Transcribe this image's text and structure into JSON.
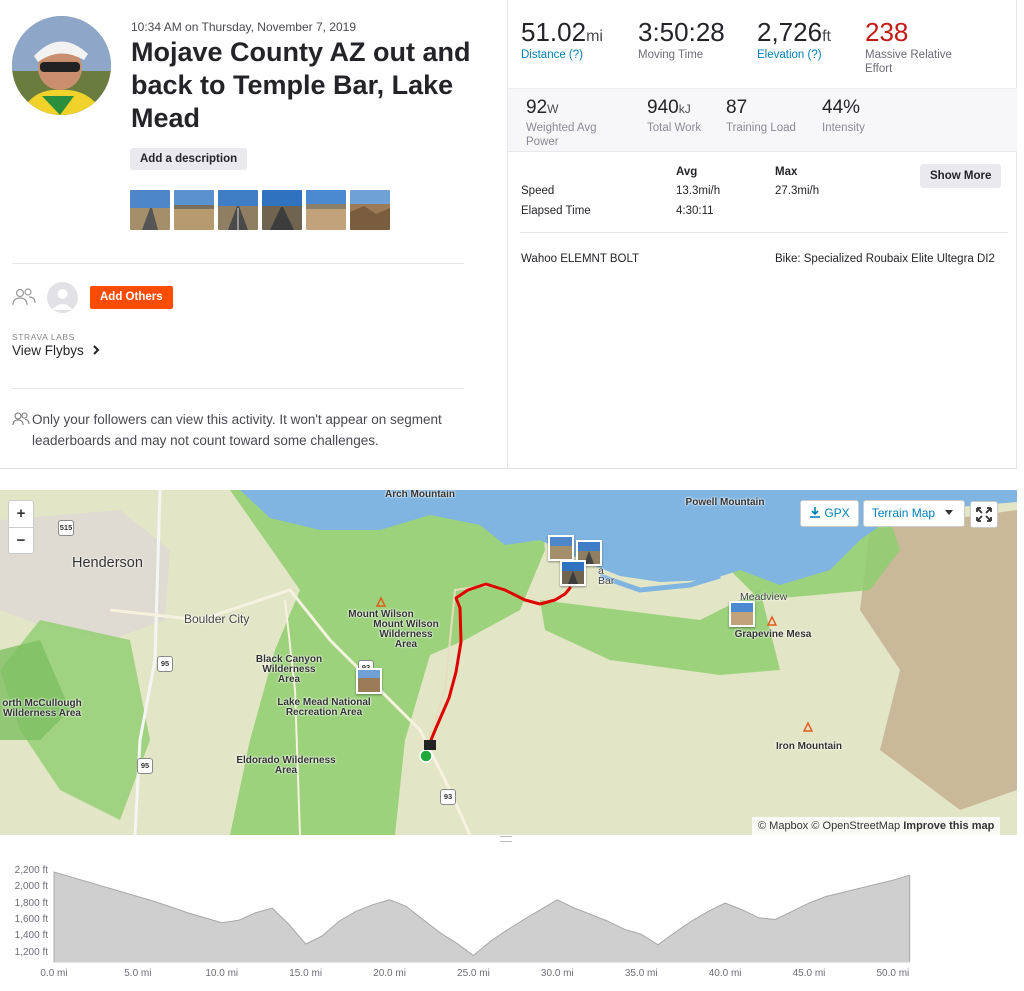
{
  "activity": {
    "timestamp": "10:34 AM on Thursday, November 7, 2019",
    "title": "Mojave County AZ out and back to Temple Bar, Lake Mead",
    "add_description_label": "Add a description",
    "photo_count": 6
  },
  "social": {
    "add_others_label": "Add Others",
    "labs_label": "STRAVA LABS",
    "flybys_label": "View Flybys",
    "privacy_text": "Only your followers can view this activity. It won't appear on segment leaderboards and may not count toward some challenges."
  },
  "stats": {
    "distance": {
      "value": "51.02",
      "unit": "mi",
      "label": "Distance (?)"
    },
    "moving_time": {
      "value": "3:50:28",
      "label": "Moving Time"
    },
    "elevation": {
      "value": "2,726",
      "unit": "ft",
      "label": "Elevation (?)"
    },
    "relative_effort": {
      "value": "238",
      "label": "Massive Relative Effort"
    }
  },
  "secondary_stats": {
    "power": {
      "value": "92",
      "unit": "W",
      "label": "Weighted Avg Power"
    },
    "work": {
      "value": "940",
      "unit": "kJ",
      "label": "Total Work"
    },
    "training_load": {
      "value": "87",
      "label": "Training Load"
    },
    "intensity": {
      "value": "44%",
      "label": "Intensity"
    }
  },
  "details_table": {
    "col_avg": "Avg",
    "col_max": "Max",
    "rows": [
      {
        "label": "Speed",
        "avg": "13.3mi/h",
        "max": "27.3mi/h"
      },
      {
        "label": "Elapsed Time",
        "avg": "4:30:11",
        "max": ""
      }
    ],
    "show_more_label": "Show More"
  },
  "device": "Wahoo ELEMNT BOLT",
  "bike": "Bike: Specialized Roubaix Elite Ultegra DI2",
  "map": {
    "gpx_label": "GPX",
    "terrain_label": "Terrain Map",
    "zoom_in": "+",
    "zoom_out": "−",
    "attribution": "© Mapbox © OpenStreetMap",
    "improve_label": "Improve this map",
    "labels": {
      "arch": "Arch Mountain",
      "powell": "Powell Mountain",
      "henderson": "Henderson",
      "boulder": "Boulder City",
      "mtwilson": "Mount Wilson",
      "mtwilsonwild": "Mount Wilson Wilderness Area",
      "blackcanyon": "Black Canyon Wilderness Area",
      "lakemead": "Lake Mead National Recreation Area",
      "mccullough": "orth McCullough Wilderness Area",
      "eldorado": "Eldorado Wilderness Area",
      "meadview": "Meadview",
      "grapevine": "Grapevine Mesa",
      "iron": "Iron Mountain",
      "templebar": "a Bar",
      "hwy515": "515",
      "hwy95a": "95",
      "hwy95b": "95",
      "hwy93a": "93",
      "hwy93b": "93"
    },
    "route_color": "#e00000",
    "water_color": "#7fb5e0",
    "park_color": "#8fce6f"
  },
  "elevation_profile": {
    "y_ticks": [
      "2,200 ft",
      "2,000 ft",
      "1,800 ft",
      "1,600 ft",
      "1,400 ft",
      "1,200 ft"
    ],
    "x_ticks": [
      "0.0 mi",
      "5.0 mi",
      "10.0 mi",
      "15.0 mi",
      "20.0 mi",
      "25.0 mi",
      "30.0 mi",
      "35.0 mi",
      "40.0 mi",
      "45.0 mi",
      "50.0 mi"
    ],
    "profile": [
      [
        0,
        2200
      ],
      [
        2,
        2080
      ],
      [
        4,
        1960
      ],
      [
        6,
        1840
      ],
      [
        8,
        1700
      ],
      [
        10,
        1580
      ],
      [
        11,
        1610
      ],
      [
        12,
        1700
      ],
      [
        13,
        1760
      ],
      [
        14,
        1560
      ],
      [
        15,
        1320
      ],
      [
        16,
        1420
      ],
      [
        17,
        1600
      ],
      [
        18,
        1720
      ],
      [
        19,
        1800
      ],
      [
        20,
        1860
      ],
      [
        21,
        1780
      ],
      [
        22,
        1620
      ],
      [
        23,
        1460
      ],
      [
        24,
        1330
      ],
      [
        25,
        1180
      ],
      [
        26,
        1350
      ],
      [
        27,
        1490
      ],
      [
        28,
        1620
      ],
      [
        29,
        1740
      ],
      [
        30,
        1860
      ],
      [
        31,
        1760
      ],
      [
        32,
        1680
      ],
      [
        33,
        1600
      ],
      [
        34,
        1500
      ],
      [
        35,
        1440
      ],
      [
        36,
        1310
      ],
      [
        37,
        1460
      ],
      [
        38,
        1600
      ],
      [
        39,
        1720
      ],
      [
        40,
        1820
      ],
      [
        41,
        1740
      ],
      [
        42,
        1640
      ],
      [
        43,
        1620
      ],
      [
        44,
        1720
      ],
      [
        45,
        1820
      ],
      [
        46,
        1900
      ],
      [
        48,
        2000
      ],
      [
        50,
        2100
      ],
      [
        51,
        2160
      ]
    ]
  }
}
